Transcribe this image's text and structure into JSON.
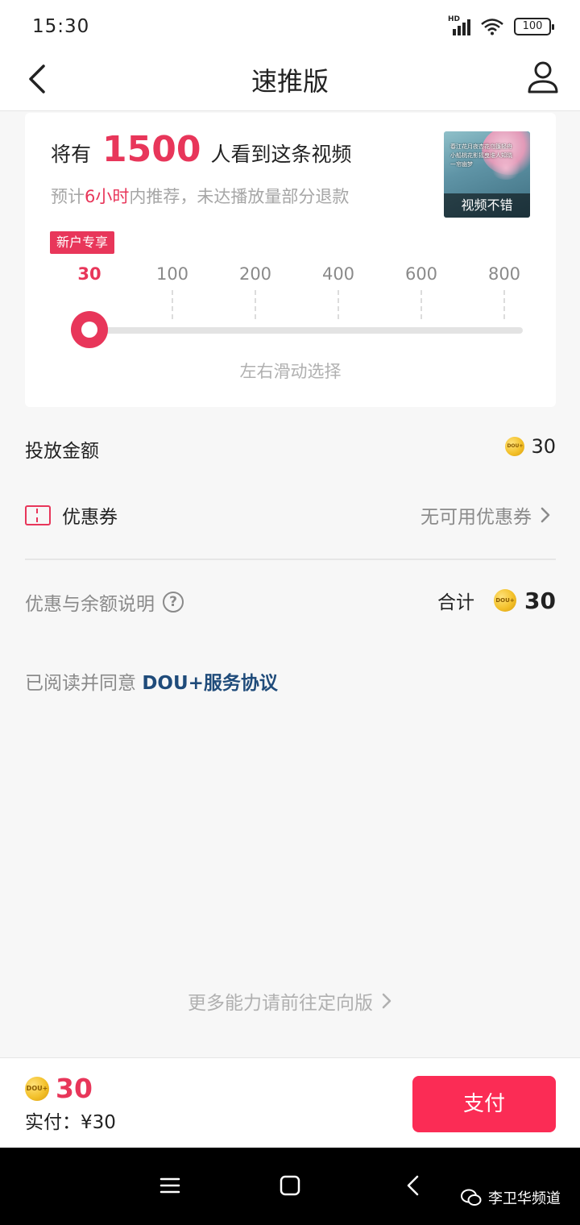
{
  "status_bar": {
    "time": "15:30",
    "network_label": "HD",
    "battery": "100"
  },
  "nav": {
    "title": "速推版",
    "back_icon": "chevron-left-icon",
    "user_icon": "user-icon"
  },
  "card": {
    "headline_prefix": "将有",
    "headline_number": "1500",
    "headline_suffix": "人看到这条视频",
    "sub_prefix": "预计",
    "sub_highlight": "6小时",
    "sub_suffix": "内推荐，未达播放量部分退款",
    "thumbnail_caption": "视频不错",
    "thumbnail_poem": "春江花月夜杏花乌篷轻舟小船桃花影摇曳谁人知晓一帘幽梦",
    "tag": "新户专享",
    "slider": {
      "options": [
        "30",
        "100",
        "200",
        "400",
        "600",
        "800"
      ],
      "selected": "30",
      "selected_index": 0
    },
    "hint": "左右滑动选择"
  },
  "amount_row": {
    "label": "投放金额",
    "coin_text": "DOU+",
    "value": "30"
  },
  "coupon_row": {
    "label": "优惠券",
    "value": "无可用优惠券"
  },
  "summary_row": {
    "label": "优惠与余额说明",
    "help_symbol": "?",
    "total_label": "合计",
    "coin_text": "DOU+",
    "total_value": "30"
  },
  "agreement": {
    "prefix": "已阅读并同意",
    "link": "DOU+服务协议"
  },
  "more": {
    "label": "更多能力请前往定向版"
  },
  "bottom": {
    "coin_text": "DOU+",
    "price": "30",
    "actual_paid": "实付：¥30",
    "pay_label": "支付"
  },
  "watermark": {
    "text": "李卫华频道"
  },
  "colors": {
    "accent": "#e8365a",
    "pay_button": "#fb2c55",
    "link": "#1f4b7a"
  }
}
